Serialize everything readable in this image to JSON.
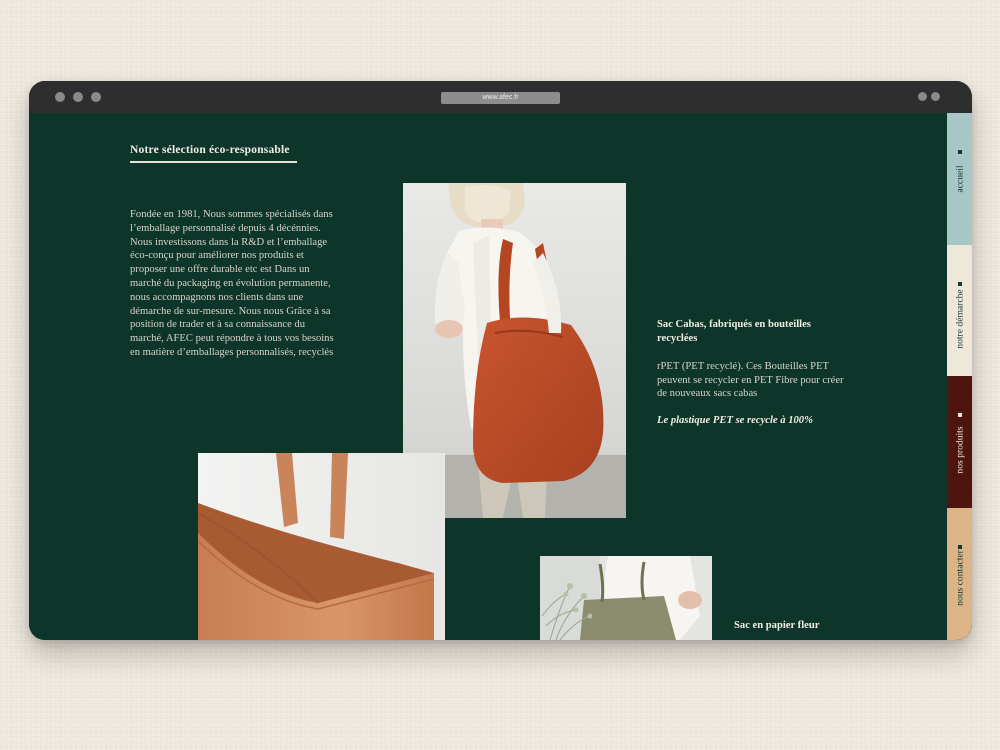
{
  "browser": {
    "url": "www.afec.fr"
  },
  "section": {
    "heading": "Notre sélection éco-responsable",
    "intro": "Fondée en 1981, Nous sommes spécialisés dans l’emballage personnalisé depuis 4 décénnies.  Nous investissons dans la R&D et l’emballage éco-conçu pour améliorer nos produits et proposer une offre durable etc est Dans un marché du packaging en évolution permanente, nous accompagnons nos clients dans une démarche de sur-mesure. Nous nous Grâce à sa position de trader et à sa connaissance du marché, AFEC peut répondre à tous vos besoins en matière d’emballages personnalisés, recyclés"
  },
  "products": [
    {
      "title": "Sac Cabas, fabriqués en bouteilles recyclées",
      "description": "rPET (PET recyclé). Ces Bouteilles PET peuvent se recycler en PET Fibre pour créer de nouveaux sacs cabas",
      "note": "Le plastique PET se recycle à 100%"
    },
    {
      "title": "Sac en papier fleur"
    }
  ],
  "nav": [
    {
      "label": "accueil",
      "bg": "#a9c6c7",
      "fg": "#123a2f"
    },
    {
      "label": "notre démarche",
      "bg": "#efe7d7",
      "fg": "#123a2f"
    },
    {
      "label": "nos produits",
      "bg": "#4e150e",
      "fg": "#efe7d7"
    },
    {
      "label": "nous contacter",
      "bg": "#ddb388",
      "fg": "#123a2f"
    }
  ],
  "colors": {
    "page_bg": "#efe9df",
    "site_bg": "#0d3529",
    "titlebar": "#2e2e2e"
  }
}
